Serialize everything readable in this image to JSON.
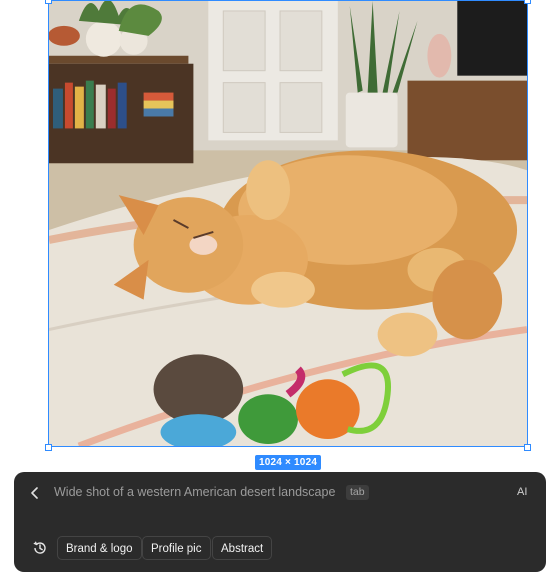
{
  "canvas": {
    "image_description_icon": "photo-cat-on-blanket",
    "size_label": "1024 × 1024",
    "accent_color": "#2f8bff"
  },
  "prompt_panel": {
    "back_icon": "chevron-left-icon",
    "placeholder": "Wide shot of a western American desert landscape",
    "tab_hint": "tab",
    "ai_label": "AI",
    "history_icon": "history-icon",
    "suggestions": [
      {
        "label": "Brand & logo"
      },
      {
        "label": "Profile pic"
      },
      {
        "label": "Abstract"
      }
    ]
  }
}
